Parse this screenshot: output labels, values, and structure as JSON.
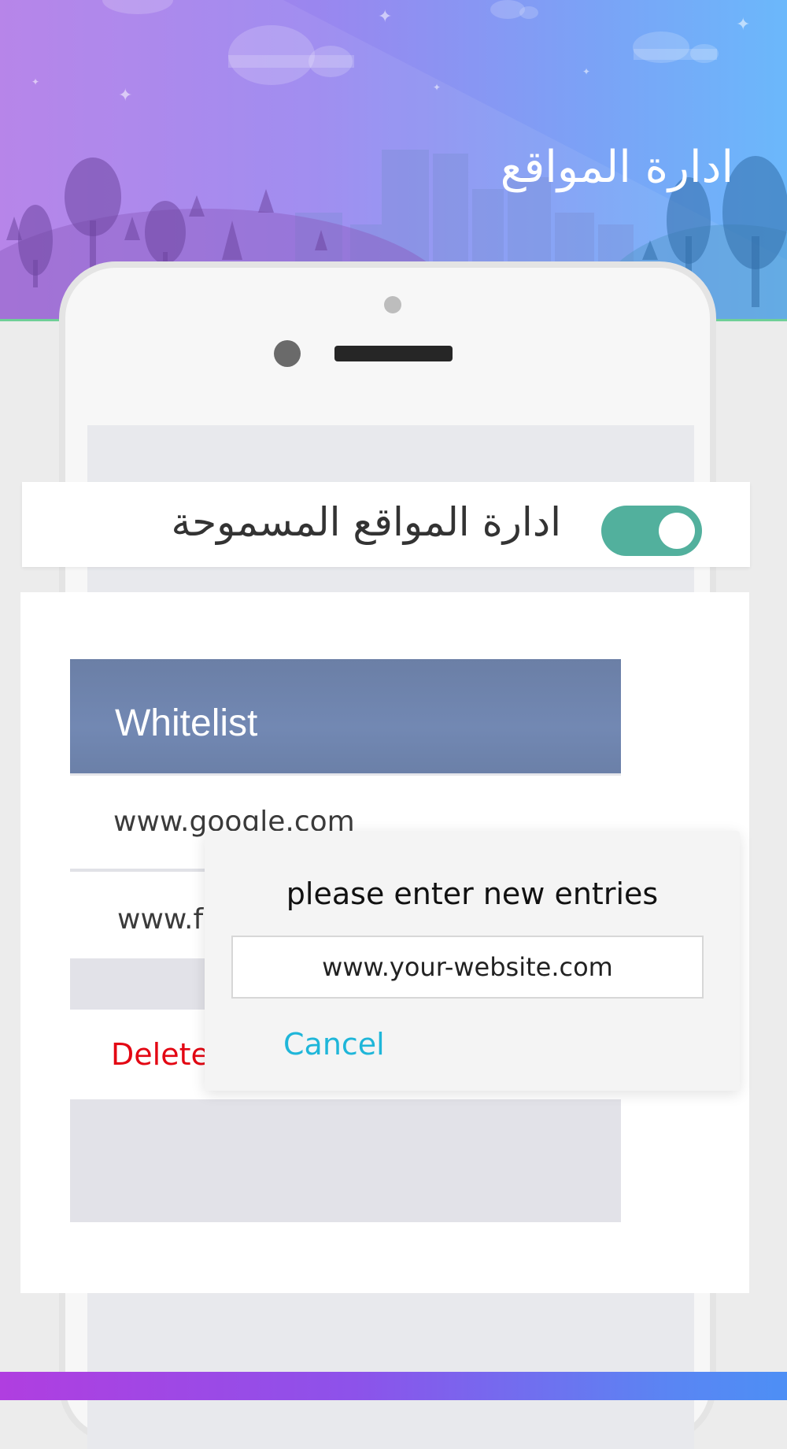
{
  "header": {
    "title": "ادارة المواقع"
  },
  "toggle_row": {
    "label": "ادارة المواقع المسموحة",
    "enabled": true
  },
  "whitelist": {
    "title": "Whitelist",
    "entries": [
      "www.google.com",
      "www.f"
    ],
    "delete_label": "Delete"
  },
  "dialog": {
    "title": "please enter new entries",
    "input_value": "www.your-website.com",
    "cancel_label": "Cancel"
  },
  "colors": {
    "toggle_on": "#52b09d",
    "delete_red": "#e30613",
    "cancel_cyan": "#1fb6d9",
    "list_header": "#6b7fa6"
  }
}
